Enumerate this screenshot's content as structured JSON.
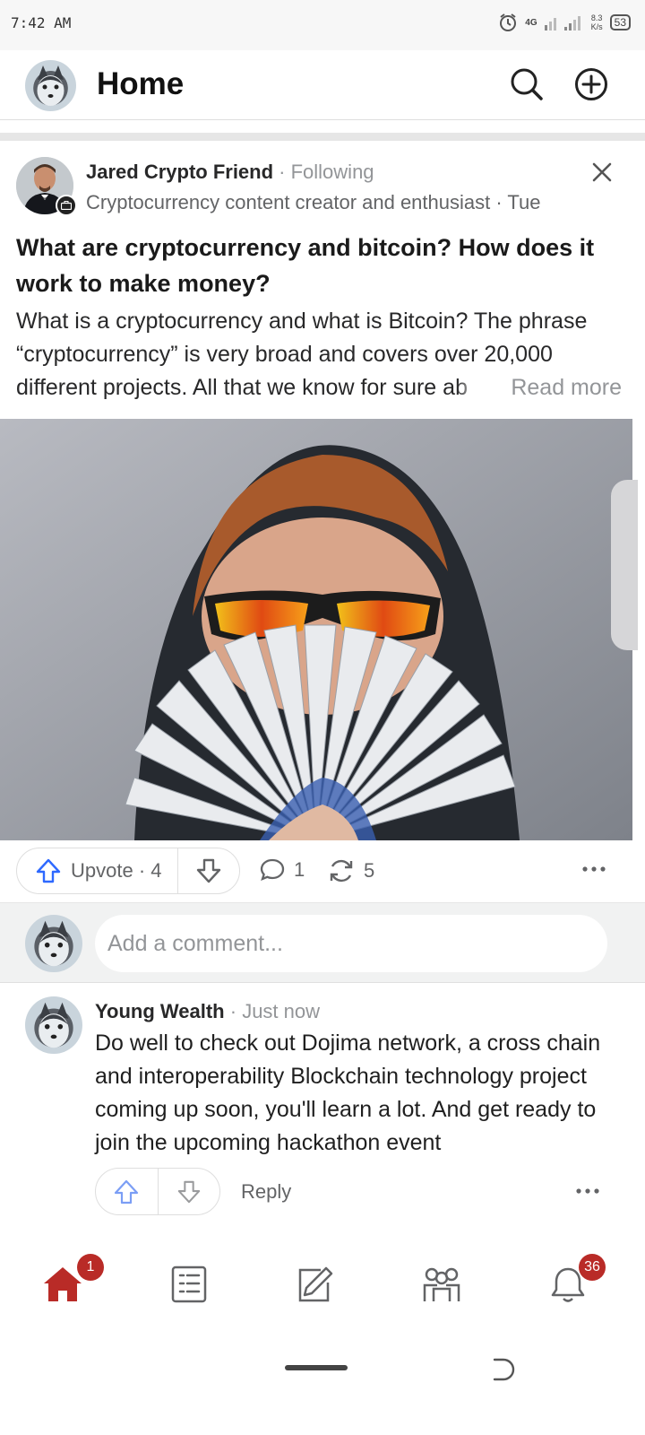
{
  "status_bar": {
    "time": "7:42 AM",
    "network": "4G",
    "speed_value": "8.3",
    "speed_unit": "K/s",
    "battery": "53"
  },
  "header": {
    "title": "Home"
  },
  "post": {
    "author_name": "Jared Crypto Friend",
    "follow_status": "· Following",
    "author_credential": "Cryptocurrency content creator and enthusiast · Tue",
    "title": "What are cryptocurrency and bitcoin? How does it work to make money?",
    "body": "What is a cryptocurrency and what is Bitcoin? The phrase “cryptocurrency” is very broad and covers over 20,000 different projects. All that we know for sure ab",
    "read_more": "Read more",
    "upvote_label": "Upvote · 4",
    "comment_count": "1",
    "share_count": "5"
  },
  "composer": {
    "placeholder": "Add a comment..."
  },
  "comment": {
    "author": "Young Wealth",
    "time": "· Just now",
    "text": "Do well to check out Dojima network, a cross chain and interoperability Blockchain technology project coming up soon, you'll learn a lot. And get ready to join the upcoming hackathon event",
    "reply_label": "Reply"
  },
  "bottom_nav": {
    "home_badge": "1",
    "notifications_badge": "36"
  },
  "colors": {
    "brand_red": "#b92b27",
    "upvote_blue": "#2e69ff"
  }
}
